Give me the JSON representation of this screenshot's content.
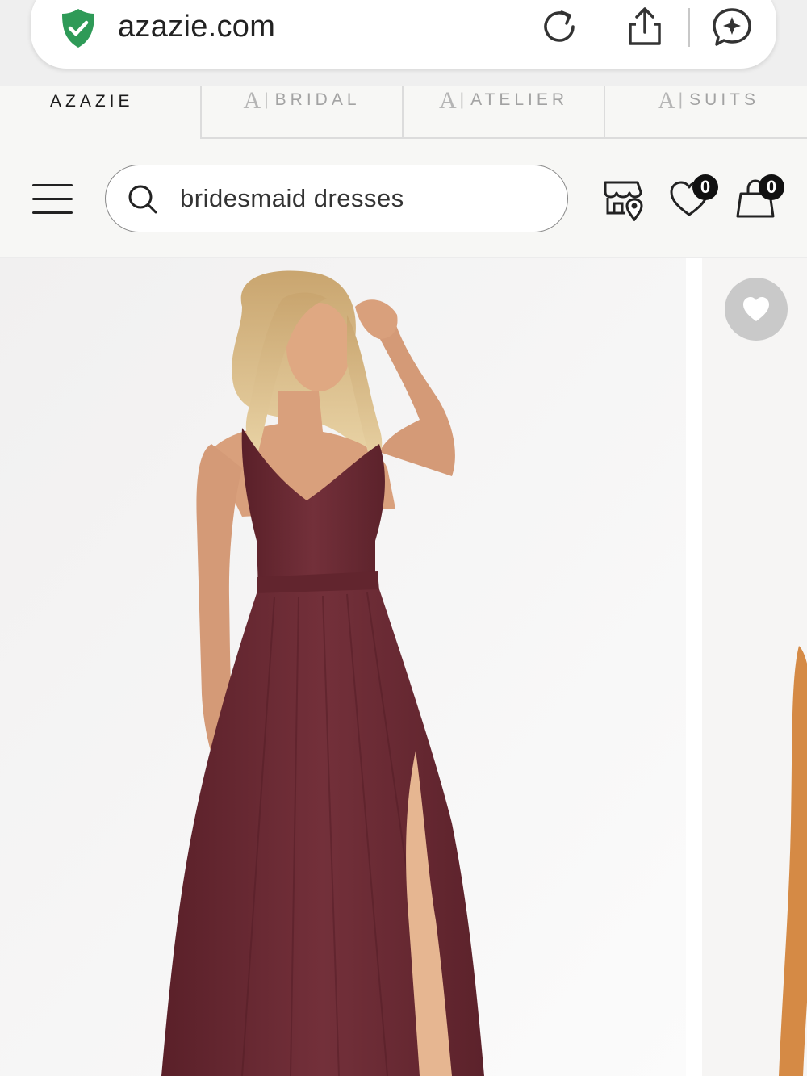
{
  "browser": {
    "url": "azazie.com",
    "icons": [
      "shield-check-icon",
      "reload-icon",
      "share-icon",
      "assistant-icon"
    ]
  },
  "brand_tabs": {
    "items": [
      {
        "label": "AZAZIE",
        "active": true
      },
      {
        "label": "BRIDAL",
        "active": false
      },
      {
        "label": "ATELIER",
        "active": false
      },
      {
        "label": "SUITS",
        "active": false
      }
    ]
  },
  "header": {
    "search_value": "bridesmaid dresses",
    "wishlist_count": "0",
    "cart_count": "0",
    "icons": [
      "menu-icon",
      "search-icon",
      "store-locator-icon",
      "heart-icon",
      "cart-bag-icon"
    ]
  },
  "product": {
    "dress_color": "#6b2a33",
    "icons": [
      "wishlist-heart-icon"
    ]
  },
  "colors": {
    "shield": "#2e9a57",
    "badge": "#111111"
  }
}
